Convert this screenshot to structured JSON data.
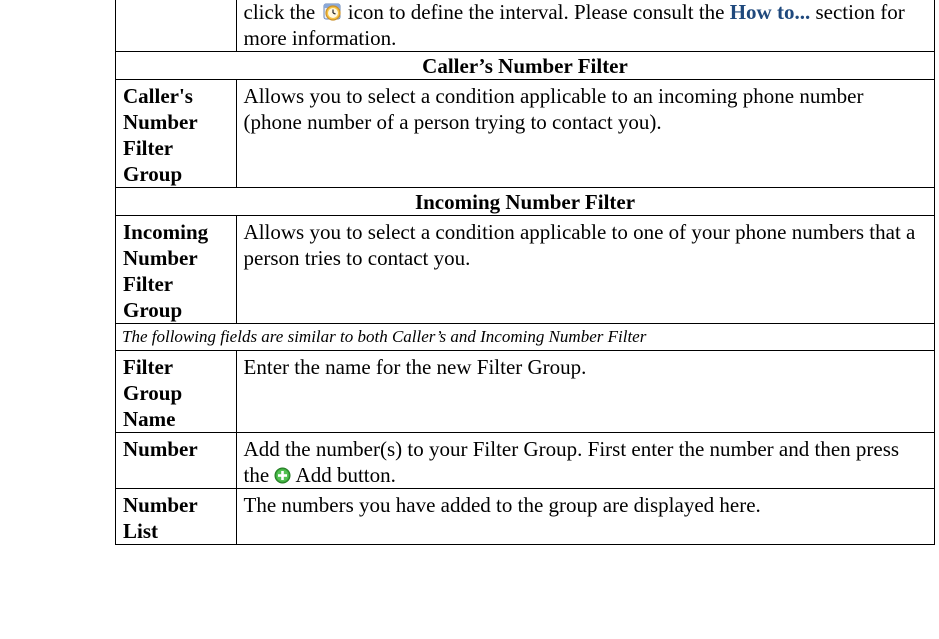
{
  "intro": {
    "line_before_icon": "click the",
    "line_after_icon": " icon to define the interval. Please consult the ",
    "link": "How to...",
    "line_end": " section for more information.",
    "icon": "clock-calendar-icon"
  },
  "callers_section": {
    "title": "Caller’s Number Filter"
  },
  "callers_row": {
    "label": "Caller's Number Filter Group",
    "description": "Allows you to select a condition applicable to an incoming phone number (phone number of a person trying to contact you)."
  },
  "incoming_section": {
    "title": "Incoming Number Filter"
  },
  "incoming_row": {
    "label": "Incoming Number Filter Group",
    "description": "Allows you to select a condition applicable to one of your phone numbers that a person tries to contact you."
  },
  "note": "The following fields are similar to both Caller’s and Incoming Number Filter",
  "filter_name_row": {
    "label": "Filter Group Name",
    "description": "Enter the name for the new Filter Group."
  },
  "number_row": {
    "label": "Number",
    "description_before_icon": "Add the number(s) to your Filter Group. First enter the number and then press the ",
    "description_after_icon": " Add button.",
    "icon": "add-plus-icon"
  },
  "number_list_row": {
    "label": "Number List",
    "description": "The numbers you have added to the group are displayed here."
  },
  "colors": {
    "link": "#1f497d",
    "add_icon": "#3aa53a"
  }
}
